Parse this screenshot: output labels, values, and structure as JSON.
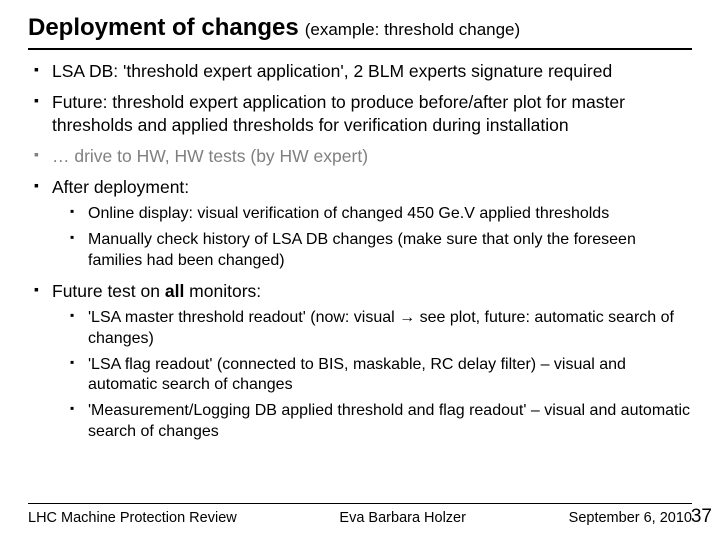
{
  "title": {
    "main": "Deployment of changes",
    "sub": "(example: threshold change)"
  },
  "bullets": {
    "b1": "LSA DB: 'threshold expert application', 2 BLM experts signature required",
    "b2": "Future: threshold expert application to produce before/after plot for master thresholds and applied thresholds for verification during installation",
    "b3": "… drive to HW, HW tests (by HW expert)",
    "b4": "After deployment:",
    "b4s1": "Online display: visual verification of changed 450 Ge.V applied thresholds",
    "b4s2": "Manually check history of LSA DB changes (make sure that only the foreseen families had been changed)",
    "b5_pre": "Future test on ",
    "b5_bold": "all",
    "b5_post": " monitors:",
    "b5s1_pre": "'LSA master threshold readout' (now: visual ",
    "b5s1_arrow": "→",
    "b5s1_post": " see plot, future: automatic search of changes)",
    "b5s2": "'LSA flag readout' (connected to BIS, maskable, RC delay filter) – visual and automatic search of changes",
    "b5s3": "'Measurement/Logging DB applied threshold and flag readout' – visual and automatic search of changes"
  },
  "footer": {
    "left": "LHC Machine Protection Review",
    "center": "Eva Barbara Holzer",
    "right": "September 6, 2010",
    "page": "37"
  }
}
